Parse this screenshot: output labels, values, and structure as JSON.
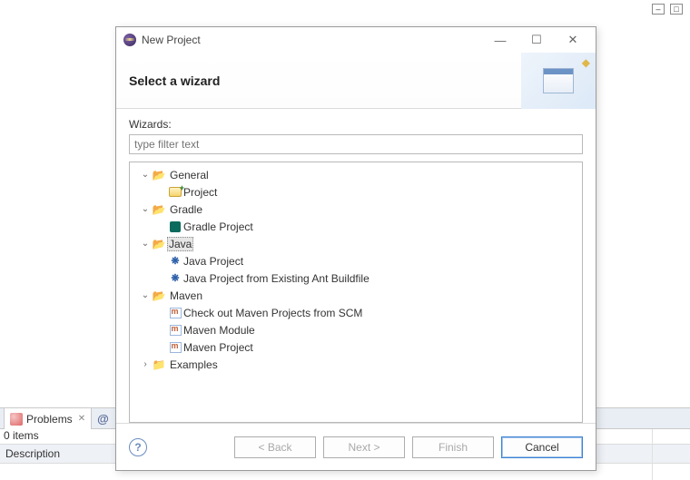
{
  "app_controls": {
    "min": "–",
    "max": "□"
  },
  "tabs_bar": {
    "problems_label": "Problems",
    "javadoc_label": "@"
  },
  "status": "0 items",
  "desc_header": "Description",
  "dialog": {
    "title": "New Project",
    "banner_title": "Select a wizard",
    "wizards_label": "Wizards:",
    "filter_placeholder": "type filter text",
    "buttons": {
      "back": "< Back",
      "next": "Next >",
      "finish": "Finish",
      "cancel": "Cancel"
    },
    "tree": {
      "general": {
        "label": "General",
        "children": [
          {
            "label": "Project"
          }
        ]
      },
      "gradle": {
        "label": "Gradle",
        "children": [
          {
            "label": "Gradle Project"
          }
        ]
      },
      "java": {
        "label": "Java",
        "selected": true,
        "children": [
          {
            "label": "Java Project"
          },
          {
            "label": "Java Project from Existing Ant Buildfile"
          }
        ]
      },
      "maven": {
        "label": "Maven",
        "children": [
          {
            "label": "Check out Maven Projects from SCM"
          },
          {
            "label": "Maven Module"
          },
          {
            "label": "Maven Project"
          }
        ]
      },
      "examples": {
        "label": "Examples"
      }
    }
  }
}
